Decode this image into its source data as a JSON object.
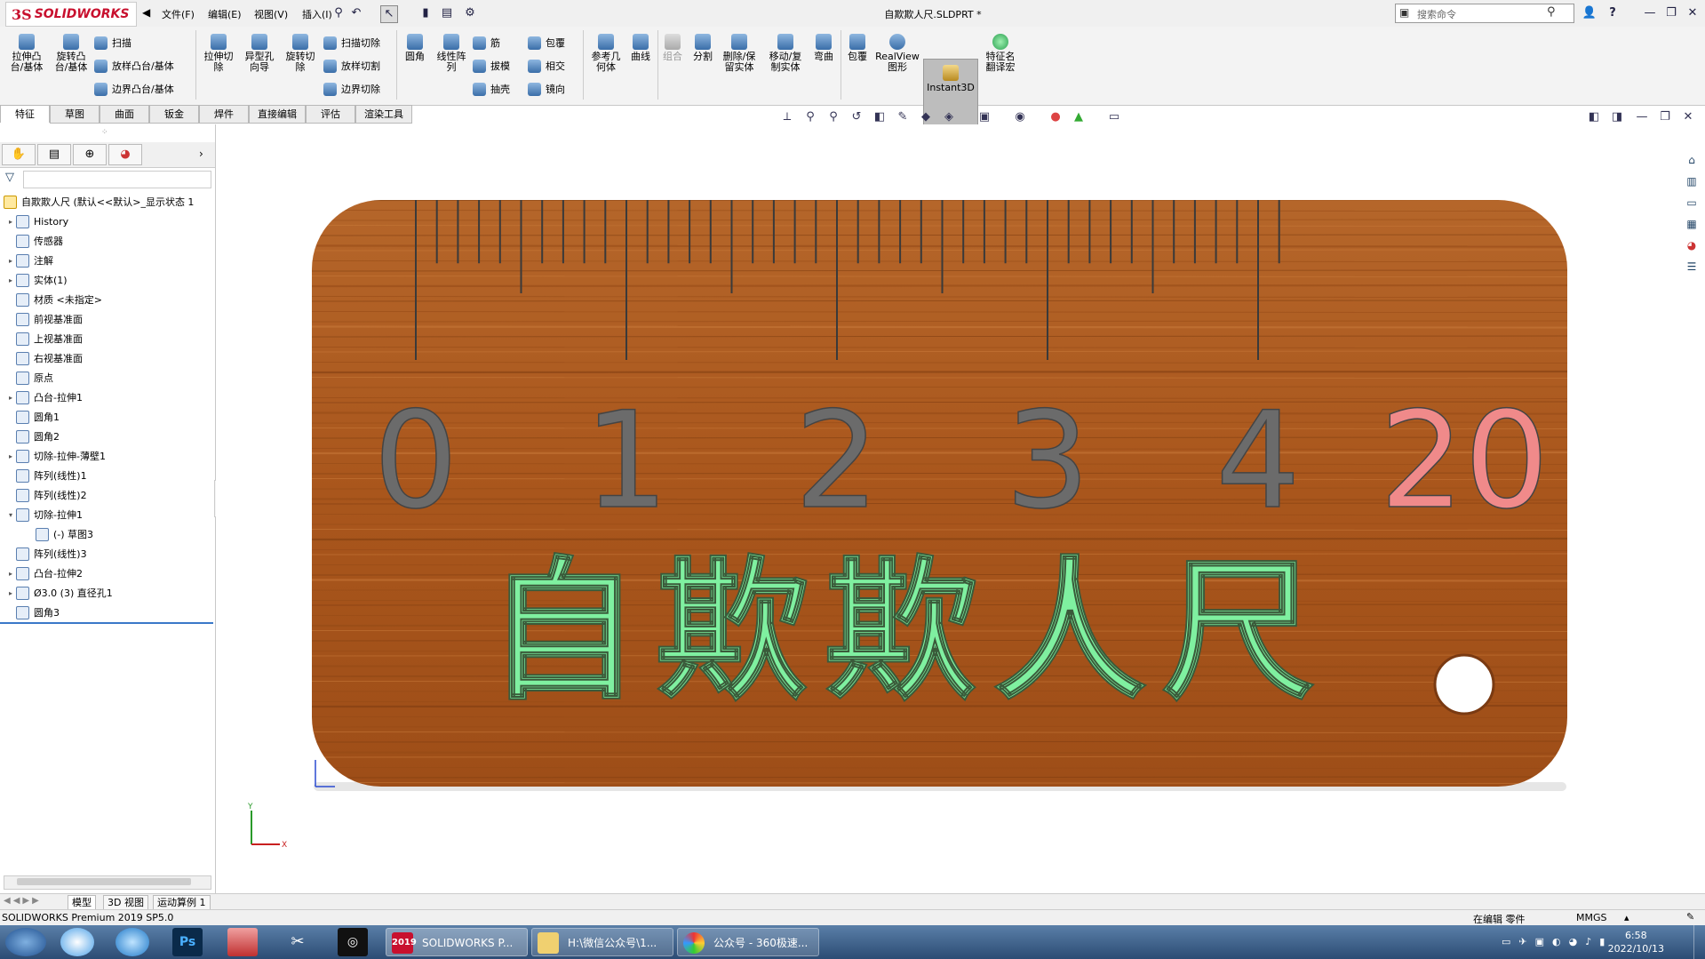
{
  "app": {
    "logo_ds": "3S",
    "logo_name": "SOLIDWORKS",
    "doc_title": "自欺欺人尺.SLDPRT *"
  },
  "menu": [
    "文件(F)",
    "编辑(E)",
    "视图(V)",
    "插入(I)"
  ],
  "search": {
    "placeholder": "搜索命令"
  },
  "window_controls": {
    "help": "?",
    "minimize": "—",
    "restore": "❐",
    "close": "✕"
  },
  "command_manager": {
    "big": [
      {
        "label": "拉伸凸\n台/基体"
      },
      {
        "label": "旋转凸\n台/基体"
      },
      {
        "label": "拉伸切\n除"
      },
      {
        "label": "异型孔\n向导"
      },
      {
        "label": "旋转切\n除"
      },
      {
        "label": "圆角"
      },
      {
        "label": "线性阵\n列"
      },
      {
        "label": "参考几\n何体"
      },
      {
        "label": "曲线"
      },
      {
        "label": "组合"
      },
      {
        "label": "分割"
      },
      {
        "label": "删除/保\n留实体"
      },
      {
        "label": "移动/复\n制实体"
      },
      {
        "label": "弯曲"
      },
      {
        "label": "包覆"
      },
      {
        "label": "RealView\n图形"
      },
      {
        "label": "Instant3D"
      },
      {
        "label": "特征名\n翻译宏"
      }
    ],
    "small": [
      "扫描",
      "放样凸台/基体",
      "边界凸台/基体",
      "扫描切除",
      "放样切割",
      "边界切除",
      "筋",
      "拔模",
      "抽壳",
      "包覆",
      "相交",
      "镜向"
    ]
  },
  "tabs": [
    "特征",
    "草图",
    "曲面",
    "钣金",
    "焊件",
    "直接编辑",
    "评估",
    "渲染工具"
  ],
  "tree": {
    "root": "自欺欺人尺  (默认<<默认>_显示状态 1",
    "items": [
      {
        "label": "History",
        "arrow": "▸"
      },
      {
        "label": "传感器",
        "arrow": ""
      },
      {
        "label": "注解",
        "arrow": "▸"
      },
      {
        "label": "实体(1)",
        "arrow": "▸"
      },
      {
        "label": "材质 <未指定>",
        "arrow": ""
      },
      {
        "label": "前视基准面",
        "arrow": ""
      },
      {
        "label": "上视基准面",
        "arrow": ""
      },
      {
        "label": "右视基准面",
        "arrow": ""
      },
      {
        "label": "原点",
        "arrow": ""
      },
      {
        "label": "凸台-拉伸1",
        "arrow": "▸"
      },
      {
        "label": "圆角1",
        "arrow": ""
      },
      {
        "label": "圆角2",
        "arrow": ""
      },
      {
        "label": "切除-拉伸-薄壁1",
        "arrow": "▸"
      },
      {
        "label": "阵列(线性)1",
        "arrow": ""
      },
      {
        "label": "阵列(线性)2",
        "arrow": ""
      },
      {
        "label": "切除-拉伸1",
        "arrow": "▾"
      },
      {
        "label": "(-) 草图3",
        "arrow": ""
      },
      {
        "label": "阵列(线性)3",
        "arrow": ""
      },
      {
        "label": "凸台-拉伸2",
        "arrow": "▸"
      },
      {
        "label": "Ø3.0 (3) 直径孔1",
        "arrow": "▸"
      },
      {
        "label": "圆角3",
        "arrow": ""
      }
    ]
  },
  "model": {
    "numbers": [
      "0",
      "1",
      "2",
      "3",
      "4",
      "20"
    ],
    "engraving": "自欺欺人尺",
    "colors": {
      "wood": "#a8571f",
      "digits": "#6b6b6b",
      "last_digit": "#f08a8a",
      "text": "#7ff0a0"
    }
  },
  "bottom_tabs": [
    "模型",
    "3D 视图",
    "运动算例 1"
  ],
  "status": {
    "left": "SOLIDWORKS Premium 2019 SP5.0",
    "mode": "在编辑 零件",
    "units": "MMGS"
  },
  "taskbar": {
    "tasks": [
      "SOLIDWORKS P...",
      "H:\\微信公众号\\1...",
      "公众号 - 360极速..."
    ],
    "time": "6:58",
    "date": "2022/10/13",
    "sw_badge": "2019"
  }
}
